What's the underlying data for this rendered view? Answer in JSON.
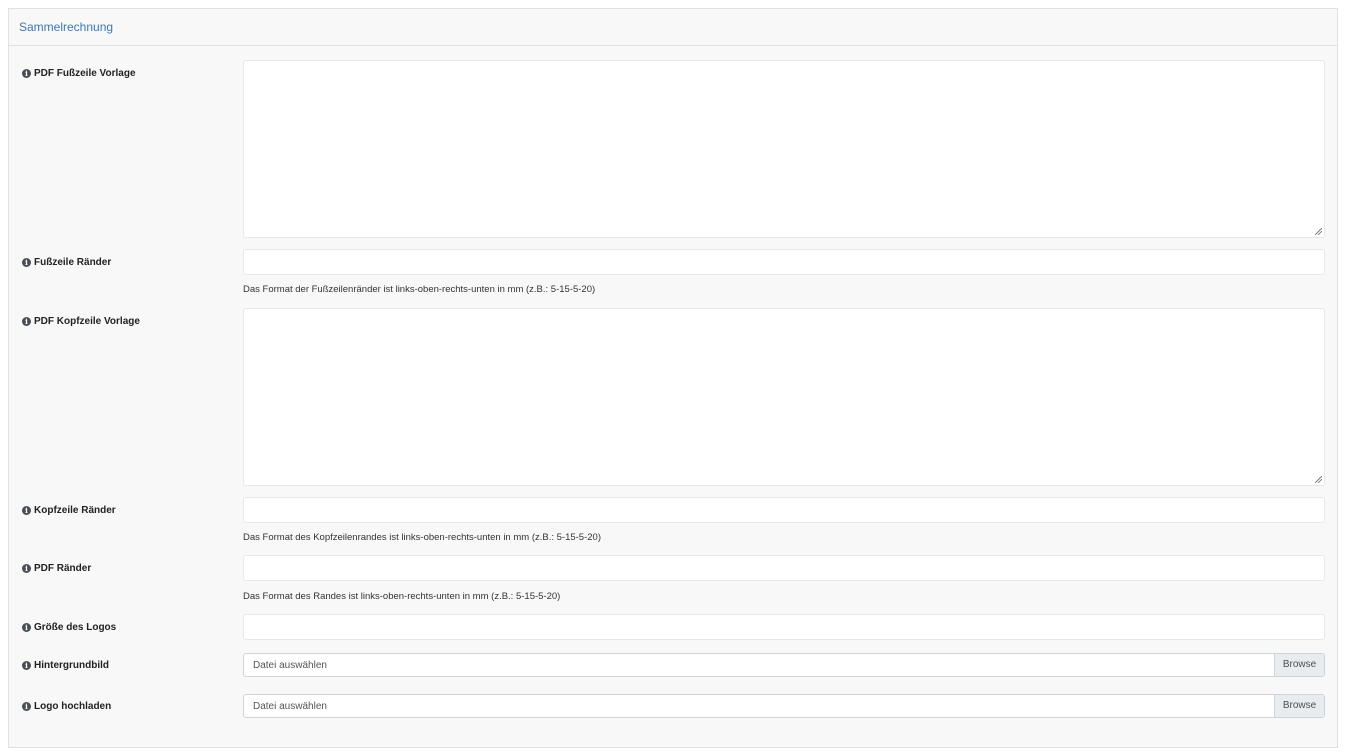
{
  "panel": {
    "title": "Sammelrechnung"
  },
  "fields": {
    "pdf_footer_template": {
      "label": "PDF Fußzeile Vorlage",
      "value": ""
    },
    "footer_margins": {
      "label": "Fußzeile Ränder",
      "value": "",
      "help": "Das Format der Fußzeilenränder ist links-oben-rechts-unten in mm (z.B.: 5-15-5-20)"
    },
    "pdf_header_template": {
      "label": "PDF Kopfzeile Vorlage",
      "value": ""
    },
    "header_margins": {
      "label": "Kopfzeile Ränder",
      "value": "",
      "help": "Das Format des Kopfzeilenrandes ist links-oben-rechts-unten in mm (z.B.: 5-15-5-20)"
    },
    "pdf_margins": {
      "label": "PDF Ränder",
      "value": "",
      "help": "Das Format des Randes ist links-oben-rechts-unten in mm (z.B.: 5-15-5-20)"
    },
    "logo_size": {
      "label": "Größe des Logos",
      "value": ""
    },
    "background_image": {
      "label": "Hintergrundbild",
      "placeholder": "Datei auswählen",
      "button": "Browse"
    },
    "logo_upload": {
      "label": "Logo hochladen",
      "placeholder": "Datei auswählen",
      "button": "Browse"
    }
  },
  "icons": {
    "info": "info-circle-icon",
    "info_glyph": "i"
  },
  "colors": {
    "title": "#3c78b4",
    "panel_bg": "#f8f8f8",
    "icon": "#4a4f55"
  }
}
